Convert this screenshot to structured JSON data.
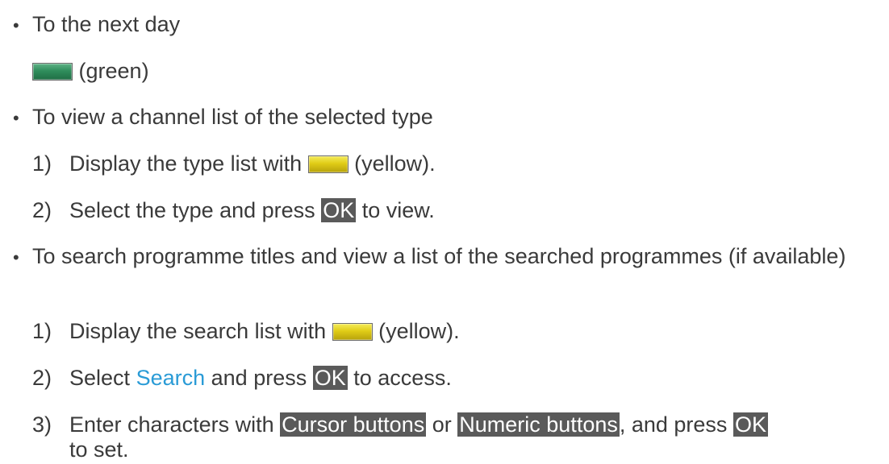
{
  "items": {
    "next_day": {
      "bullet": "•",
      "text": "To the next day",
      "sub": {
        "color_label": "(green)",
        "icon": "green-button-icon",
        "color": "#2f8d5c"
      }
    },
    "channel_list": {
      "bullet": "•",
      "text": "To view a channel list of the selected type",
      "steps": [
        {
          "num": "1)",
          "pre": "Display the type list with",
          "post": "(yellow).",
          "icon": "yellow-button-icon"
        },
        {
          "num": "2)",
          "pre": "Select the type and press",
          "ok": "OK",
          "post": "to view."
        }
      ]
    },
    "search": {
      "bullet": "•",
      "text": "To search programme titles and view a list of the searched programmes (if available)",
      "steps": [
        {
          "num": "1)",
          "pre": "Display the search list with",
          "post": "(yellow).",
          "icon": "yellow-button-icon"
        },
        {
          "num": "2)",
          "pre": "Select",
          "link": "Search",
          "mid": "and press",
          "ok": "OK",
          "post": "to access."
        },
        {
          "num": "3)",
          "pre": "Enter characters with",
          "btn1": "Cursor buttons",
          "mid": "or",
          "btn2": "Numeric buttons",
          "mid2": ", and press",
          "ok": "OK",
          "post": "to set."
        }
      ]
    }
  },
  "colors": {
    "text": "#3a3a3a",
    "highlight_bg": "#5a5a5a",
    "highlight_fg": "#ffffff",
    "link": "#2a9bd6",
    "green_button": "#2f8d5c",
    "yellow_button": "#e0cc16"
  }
}
